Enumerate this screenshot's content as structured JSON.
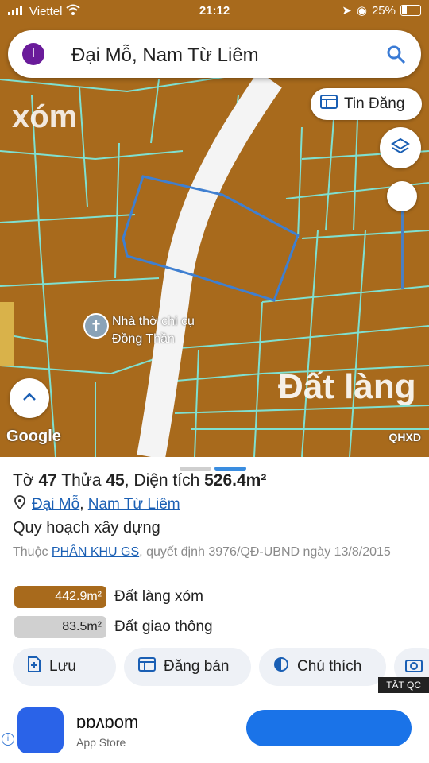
{
  "status_bar": {
    "carrier": "Viettel",
    "time": "21:12",
    "battery": "25%"
  },
  "search": {
    "app_initial": "I",
    "query": "Đại Mỗ, Nam Từ Liêm"
  },
  "map": {
    "tin_dang_label": "Tin Đăng",
    "label_xom": "xóm",
    "label_dat_lang": "Đất làng",
    "place_name": "Nhà thờ chi cụ Đồng Thần",
    "google_label": "Google",
    "layer_code": "QHXD"
  },
  "sheet": {
    "title_prefix": "Tờ",
    "to_number": "47",
    "thua_label": "Thửa",
    "thua_number": "45",
    "dien_tich_label": ", Diện tích",
    "area": "526.4m²",
    "addr_ward": "Đại Mỗ",
    "addr_sep": ", ",
    "addr_district": "Nam Từ Liêm",
    "section_title": "Quy hoạch xây dựng",
    "thuoc_prefix": "Thuộc ",
    "thuoc_link": "PHÂN KHU GS",
    "thuoc_suffix": ", quyết định 3976/QĐ-UBND ngày 13/8/2015",
    "land_uses": [
      {
        "area": "442.9m²",
        "label": "Đất làng xóm",
        "color": "#a86a1c"
      },
      {
        "area": "83.5m²",
        "label": "Đất giao thông",
        "color": "#d0d0d0"
      }
    ],
    "buttons": {
      "save": "Lưu",
      "sell": "Đăng bán",
      "legend": "Chú thích"
    },
    "tat_qc": "TẮT QC"
  },
  "ad": {
    "app_name": "ɒɒᴧɒom",
    "store": "App Store"
  },
  "colors": {
    "land_brown": "#a86a1c",
    "parcel_line": "#7fe0d0",
    "link_blue": "#1a5fb4",
    "accent_blue": "#1a73e8"
  }
}
